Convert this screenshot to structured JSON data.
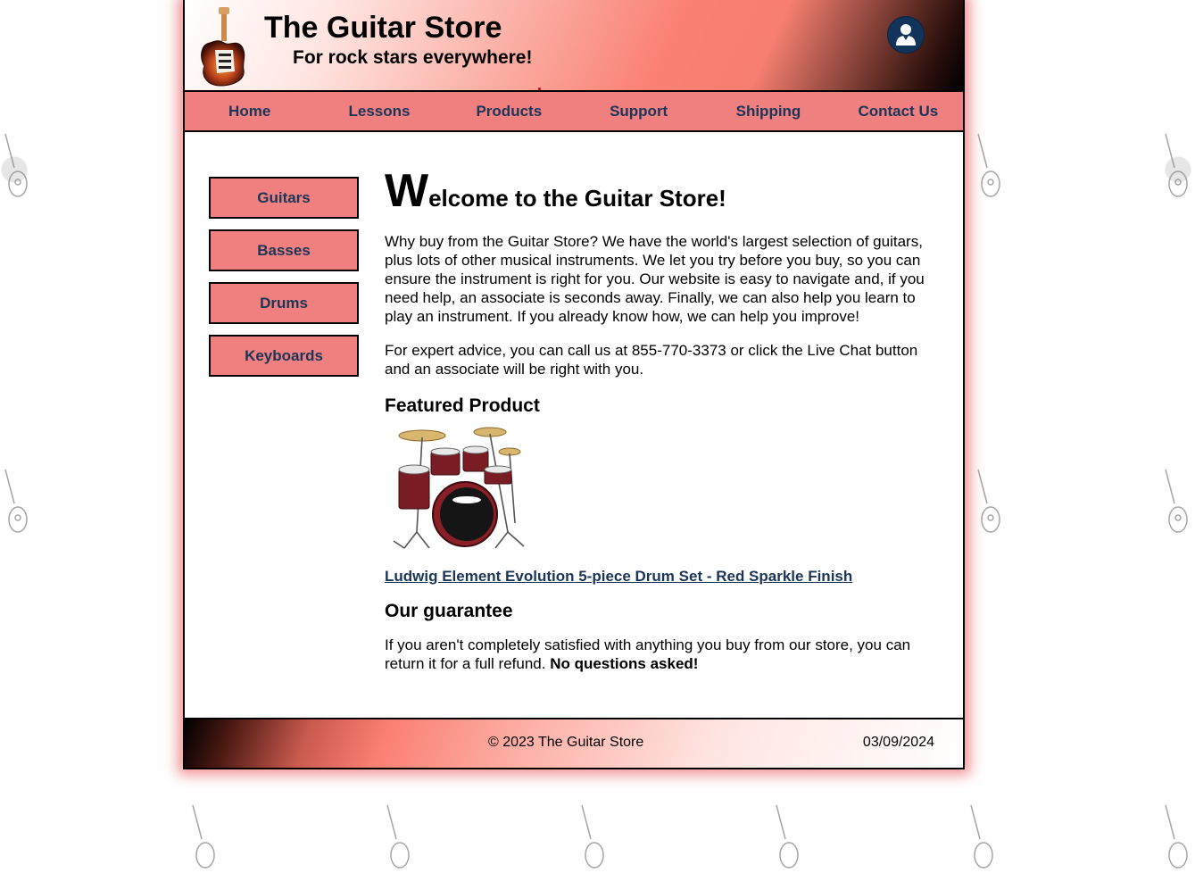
{
  "header": {
    "title": "The Guitar Store",
    "tagline": "For rock stars everywhere!"
  },
  "nav": {
    "items": [
      "Home",
      "Lessons",
      "Products",
      "Support",
      "Shipping",
      "Contact Us"
    ]
  },
  "sidebar": {
    "items": [
      "Guitars",
      "Basses",
      "Drums",
      "Keyboards"
    ]
  },
  "main": {
    "heading_first_letter": "W",
    "heading_rest": "elcome to the Guitar Store!",
    "paragraph1": "Why buy from the Guitar Store? We have the world's largest selection of guitars, plus lots of other musical instruments. We let you try before you buy, so you can ensure the instrument is right for you. Our website is easy to navigate and, if you need help, an associate is seconds away. Finally, we can also help you learn to play an instrument. If you already know how, we can help you improve!",
    "paragraph2": "For expert advice, you can call us at 855-770-3373 or click the Live Chat button and an associate will be right with you.",
    "featured_heading": "Featured Product",
    "product_link": "Ludwig Element Evolution 5-piece Drum Set - Red Sparkle Finish",
    "guarantee_heading": "Our guarantee",
    "guarantee_text": "If you aren't completely satisfied with anything you buy from our store, you can return it for a full refund. ",
    "guarantee_bold": "No questions asked!"
  },
  "footer": {
    "copyright": "© 2023 The Guitar Store",
    "date": "03/09/2024"
  },
  "colors": {
    "nav_background": "#f08080",
    "nav_text": "#1b3558",
    "user_button": "#12345b",
    "link": "#1b3558"
  },
  "icons": {
    "logo": "electric-guitar-logo",
    "user": "user-icon",
    "background": "acoustic-guitar-icon",
    "featured": "drum-set-image"
  }
}
